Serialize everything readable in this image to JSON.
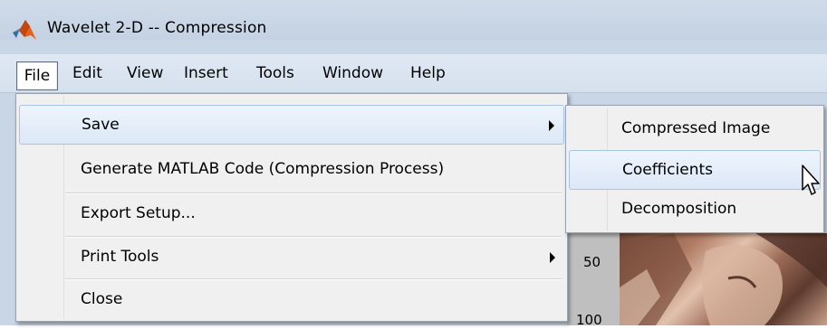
{
  "window": {
    "title": "Wavelet 2-D  --  Compression",
    "app_icon": "matlab-logo-icon"
  },
  "menubar": {
    "items": [
      "File",
      "Edit",
      "View",
      "Insert",
      "Tools",
      "Window",
      "Help"
    ],
    "active": "File"
  },
  "file_menu": {
    "items": [
      {
        "label": "Save",
        "has_submenu": true,
        "highlighted": true
      },
      {
        "label": "Generate MATLAB Code (Compression Process)",
        "has_submenu": false
      },
      {
        "label": "Export Setup...",
        "has_submenu": false
      },
      {
        "label": "Print Tools",
        "has_submenu": true
      },
      {
        "label": "Close",
        "has_submenu": false
      }
    ]
  },
  "save_submenu": {
    "items": [
      {
        "label": "Compressed Image"
      },
      {
        "label": "Coefficients",
        "highlighted": true
      },
      {
        "label": "Decomposition"
      }
    ]
  },
  "figure": {
    "ticks": [
      "50",
      "100"
    ]
  },
  "colors": {
    "chrome": "#c9d6e6",
    "menu_bg": "#f0f0f0",
    "highlight_border": "#a8c4e6",
    "axis_panel": "#bfbfbf"
  }
}
